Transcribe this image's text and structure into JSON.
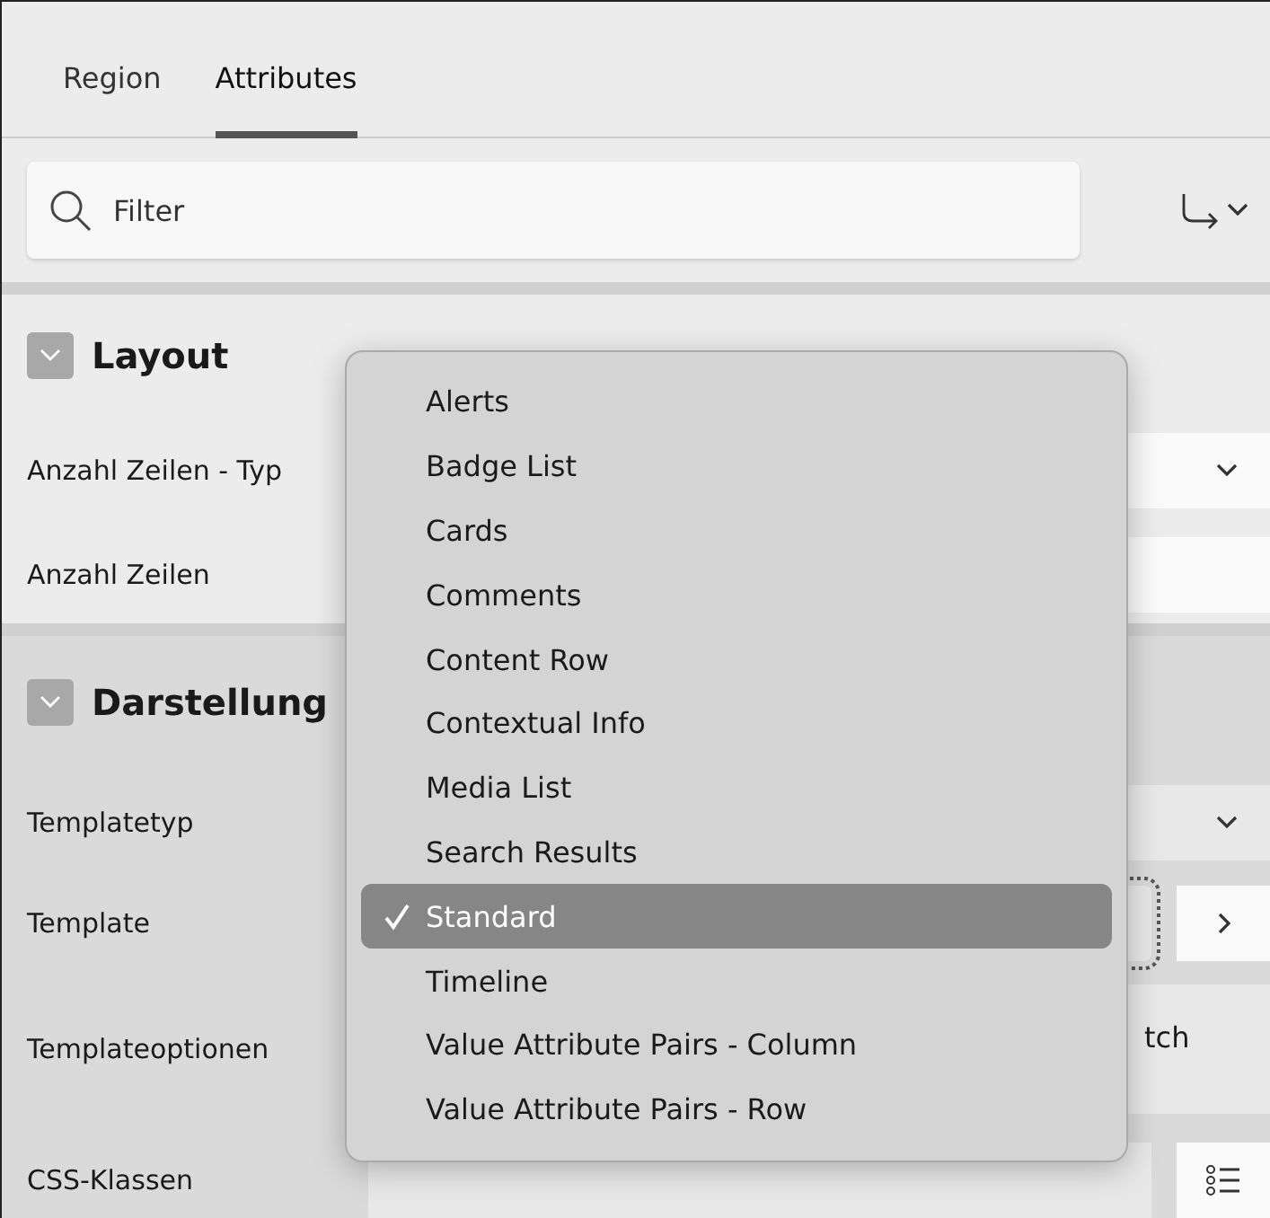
{
  "tabs": [
    {
      "label": "Region",
      "selected": false
    },
    {
      "label": "Attributes",
      "selected": true
    }
  ],
  "filter": {
    "placeholder": "Filter"
  },
  "sections": [
    {
      "title": "Layout",
      "expanded": true,
      "rows": [
        {
          "label": "Anzahl Zeilen - Typ",
          "kind": "select"
        },
        {
          "label": "Anzahl Zeilen",
          "kind": "text"
        }
      ]
    },
    {
      "title": "Darstellung",
      "expanded": true,
      "rows": [
        {
          "label": "Templatetyp",
          "kind": "select"
        },
        {
          "label": "Template",
          "kind": "picker"
        },
        {
          "label": "Templateoptionen",
          "kind": "options",
          "value": "tch"
        },
        {
          "label": "CSS-Klassen",
          "kind": "list"
        }
      ]
    }
  ],
  "dropdown": {
    "items": [
      {
        "label": "Alerts",
        "selected": false
      },
      {
        "label": "Badge List",
        "selected": false
      },
      {
        "label": "Cards",
        "selected": false
      },
      {
        "label": "Comments",
        "selected": false
      },
      {
        "label": "Content Row",
        "selected": false
      },
      {
        "label": "Contextual Info",
        "selected": false
      },
      {
        "label": "Media List",
        "selected": false
      },
      {
        "label": "Search Results",
        "selected": false
      },
      {
        "label": "Standard",
        "selected": true
      },
      {
        "label": "Timeline",
        "selected": false
      },
      {
        "label": "Value Attribute Pairs - Column",
        "selected": false
      },
      {
        "label": "Value Attribute Pairs - Row",
        "selected": false
      }
    ]
  }
}
